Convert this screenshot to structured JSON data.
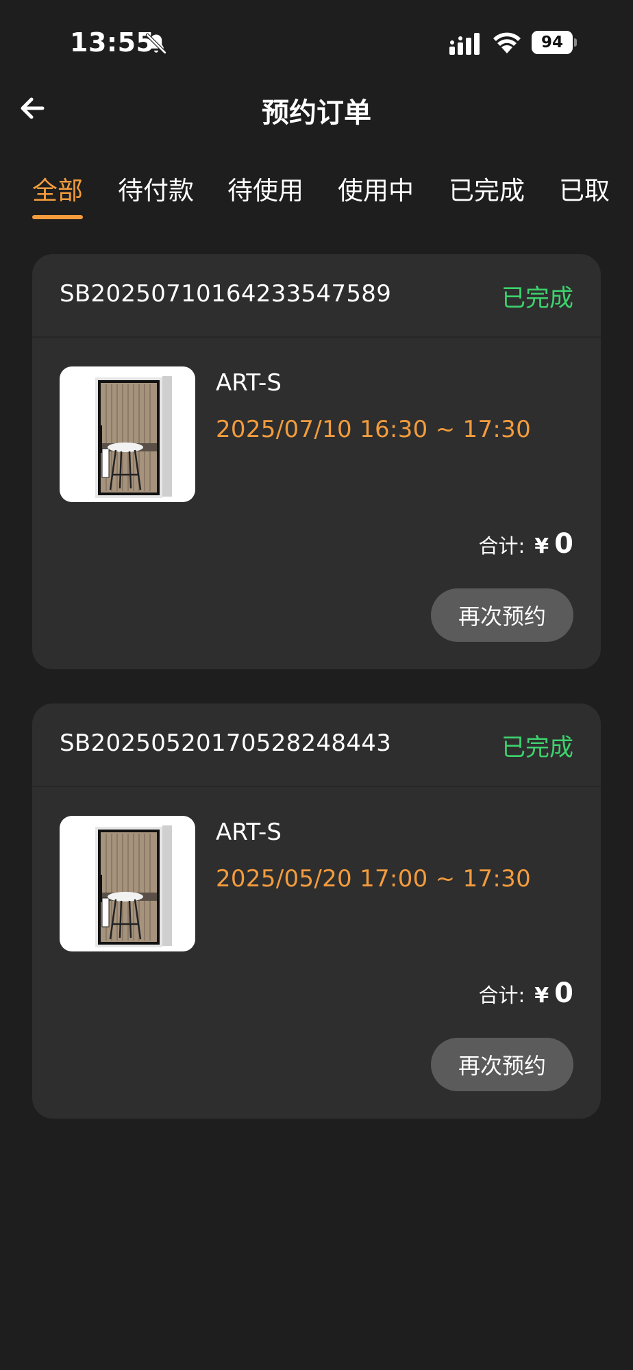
{
  "status_bar": {
    "time": "13:55",
    "battery": "94",
    "icons": [
      "bell-slash-icon",
      "signal-icon",
      "wifi-icon",
      "battery-icon"
    ]
  },
  "header": {
    "title": "预约订单",
    "back_icon": "arrow-left-icon"
  },
  "tabs": [
    {
      "label": "全部",
      "active": true
    },
    {
      "label": "待付款",
      "active": false
    },
    {
      "label": "待使用",
      "active": false
    },
    {
      "label": "使用中",
      "active": false
    },
    {
      "label": "已完成",
      "active": false
    },
    {
      "label": "已取",
      "active": false
    }
  ],
  "orders": [
    {
      "order_no": "SB20250710164233547589",
      "status": "已完成",
      "product_name": "ART-S",
      "time_range": "2025/07/10 16:30 ~ 17:30",
      "total_label": "合计:",
      "currency": "¥",
      "total": "0",
      "action_label": "再次预约"
    },
    {
      "order_no": "SB20250520170528248443",
      "status": "已完成",
      "product_name": "ART-S",
      "time_range": "2025/05/20 17:00 ~ 17:30",
      "total_label": "合计:",
      "currency": "¥",
      "total": "0",
      "action_label": "再次预约"
    }
  ],
  "colors": {
    "background": "#1e1e1e",
    "card": "#2e2e2e",
    "accent": "#f39c3d",
    "status_done": "#3dd26d",
    "button": "#5b5b5b"
  }
}
